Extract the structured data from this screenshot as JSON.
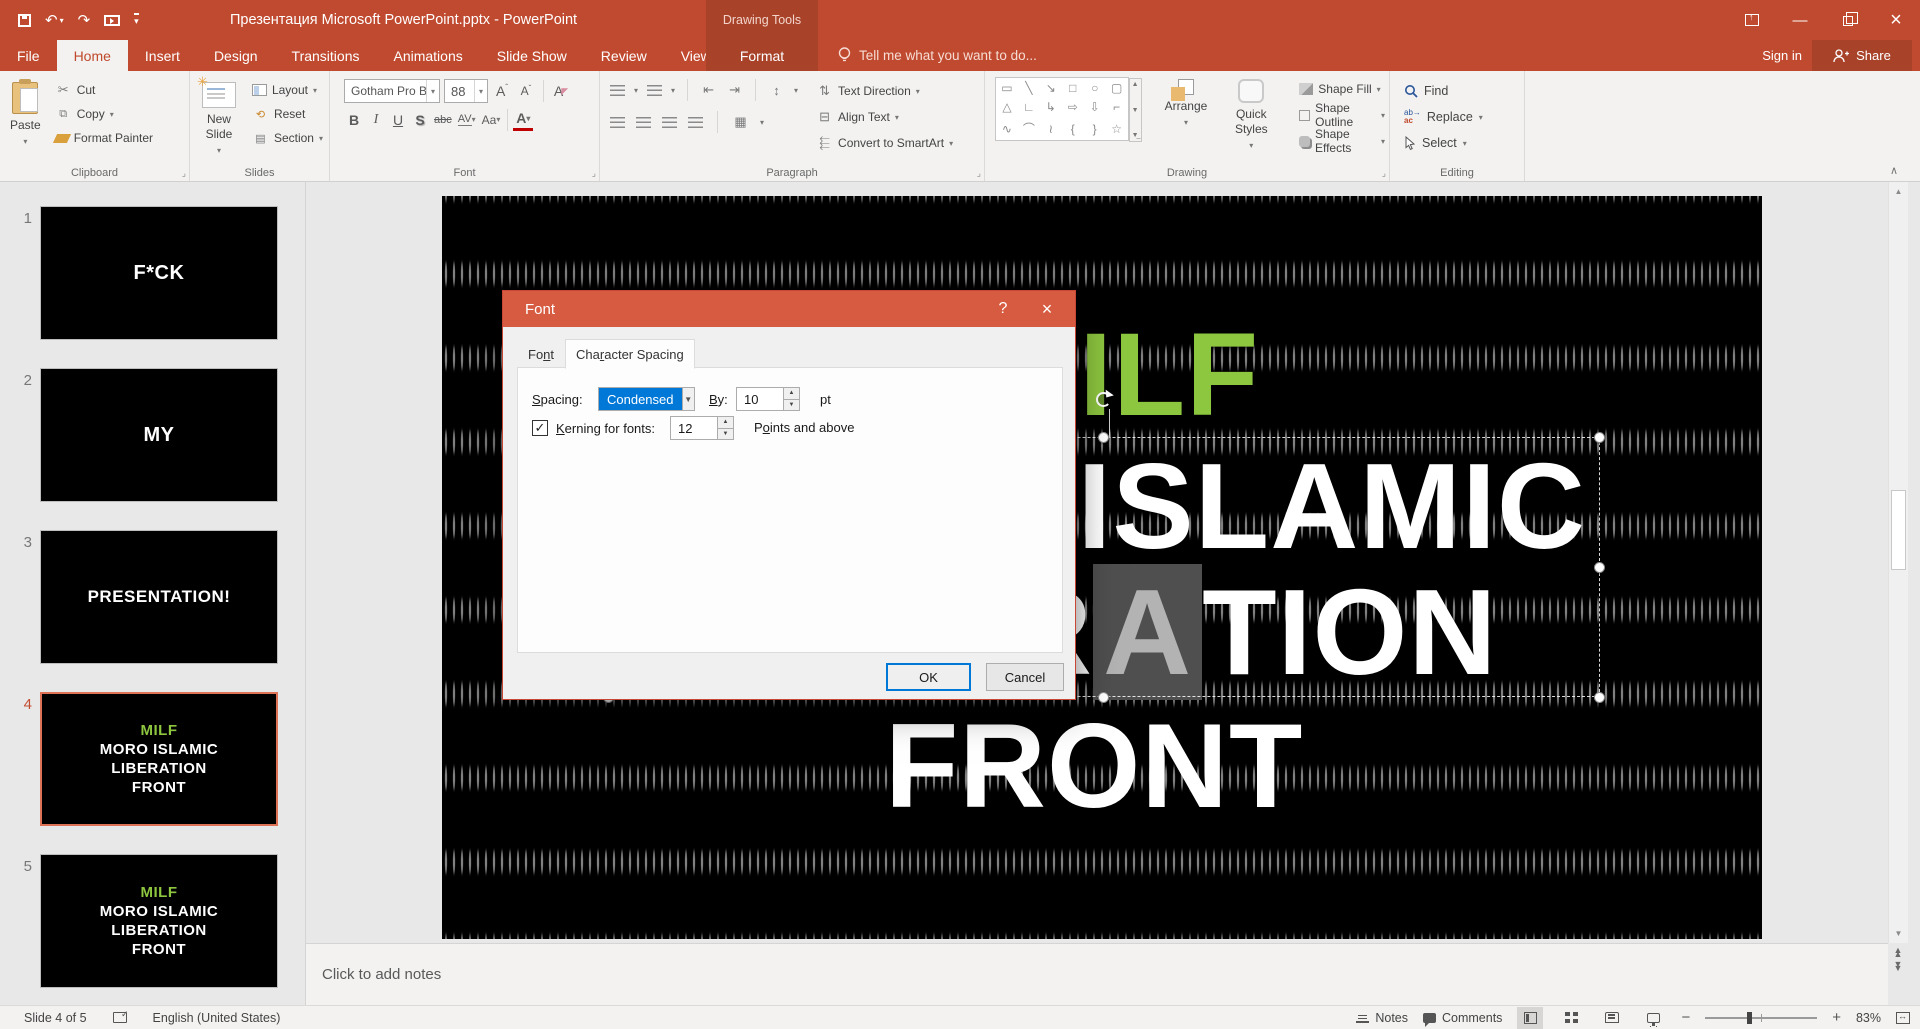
{
  "app": {
    "title": "Презентация Microsoft PowerPoint.pptx - PowerPoint",
    "context_header": "Drawing Tools",
    "tell_me": "Tell me what you want to do...",
    "sign_in": "Sign in",
    "share": "Share"
  },
  "tabs": {
    "file": "File",
    "home": "Home",
    "insert": "Insert",
    "design": "Design",
    "transitions": "Transitions",
    "animations": "Animations",
    "slide_show": "Slide Show",
    "review": "Review",
    "view": "View",
    "format": "Format"
  },
  "ribbon": {
    "clipboard": {
      "label": "Clipboard",
      "paste": "Paste",
      "cut": "Cut",
      "copy": "Copy",
      "format_painter": "Format Painter"
    },
    "slides": {
      "label": "Slides",
      "new_slide": "New Slide",
      "layout": "Layout",
      "reset": "Reset",
      "section": "Section"
    },
    "font": {
      "label": "Font",
      "family": "Gotham Pro B",
      "size": "88",
      "bold": "B",
      "italic": "I",
      "underline": "U",
      "shadow": "S",
      "strike": "abc",
      "char_spacing": "AV",
      "change_case": "Aa",
      "grow": "A",
      "shrink": "A",
      "clear": "A",
      "color": "A"
    },
    "paragraph": {
      "label": "Paragraph",
      "text_direction": "Text Direction",
      "align_text": "Align Text",
      "smartart": "Convert to SmartArt"
    },
    "drawing": {
      "label": "Drawing",
      "arrange": "Arrange",
      "quick_styles": "Quick Styles",
      "shape_fill": "Shape Fill",
      "shape_outline": "Shape Outline",
      "shape_effects": "Shape Effects",
      "shapes": [
        "▭",
        "╲",
        "↘",
        "□",
        "○",
        "▢",
        "△",
        "∟",
        "↳",
        "⇨",
        "⇩",
        "⌐",
        "∿",
        "⌒",
        "≀",
        "{",
        "}",
        "☆"
      ]
    },
    "editing": {
      "label": "Editing",
      "find": "Find",
      "replace": "Replace",
      "select": "Select",
      "replace_a": "ab",
      "replace_b": "ac"
    }
  },
  "thumbnails": [
    {
      "num": "1",
      "l1": "F*CK"
    },
    {
      "num": "2",
      "l1": "MY"
    },
    {
      "num": "3",
      "l1": "PRESENTATION!"
    },
    {
      "num": "4",
      "l1": "MILF",
      "l2": "MORO ISLAMIC",
      "l3": "LIBERATION",
      "l4": "FRONT",
      "selected": true
    },
    {
      "num": "5",
      "l1": "MILF",
      "l2": "MORO ISLAMIC",
      "l3": "LIBERATION",
      "l4": "FRONT"
    }
  ],
  "slide": {
    "line1": "MILF",
    "line2": "MORO ISLAMIC",
    "line3_pre": "LIBER",
    "line3_selected": "A",
    "line3_post": "TION",
    "line4": "FRONT",
    "green": "#8DC63F",
    "background": "#000000"
  },
  "dialog": {
    "title": "Font",
    "tab_font": {
      "text": "Font",
      "u": 2
    },
    "tab_charspacing": {
      "text": "Character Spacing",
      "u": 3
    },
    "spacing_label": {
      "text": "Spacing:",
      "u": 0
    },
    "spacing_value": "Condensed",
    "by_label": {
      "text": "By:",
      "u": 0
    },
    "by_value": "10",
    "unit": "pt",
    "kerning_label": {
      "text": "Kerning for fonts:",
      "u": 0
    },
    "kerning_value": "12",
    "points_label": {
      "text": "Points and above",
      "u": 1
    },
    "ok": "OK",
    "cancel": "Cancel",
    "accent": "#0078D7"
  },
  "notes_placeholder": "Click to add notes",
  "status": {
    "slide_indicator": "Slide 4 of 5",
    "language": "English (United States)",
    "notes": "Notes",
    "comments": "Comments",
    "zoom_percent": "83%"
  },
  "colors": {
    "chrome": "#C04A2F",
    "contextual": "#A8432A",
    "dialog_header": "#D75B40",
    "selection_border": "#DD7257"
  }
}
